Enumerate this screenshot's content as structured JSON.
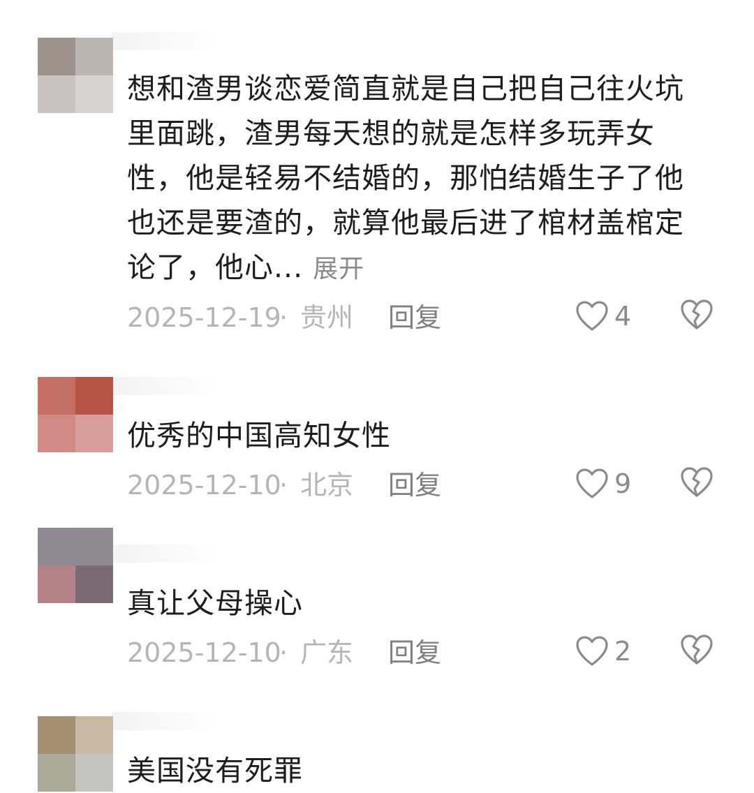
{
  "comments": [
    {
      "text": "想和渣男谈恋爱简直就是自己把自己往火坑里面跳，渣男每天想的就是怎样多玩弄女性，他是轻易不结婚的，那怕结婚生子了他也还是要渣的，就算他最后进了棺材盖棺定论了，他心...",
      "expand_label": "展开",
      "date": "2025-12-19",
      "separator": "·",
      "location": "贵州",
      "reply_label": "回复",
      "likes": "4",
      "avatar_colors": [
        "#9e938c",
        "#bcb5b0",
        "#c9c4c1",
        "#d6d3d1"
      ]
    },
    {
      "text": "优秀的中国高知女性",
      "date": "2025-12-10",
      "separator": "·",
      "location": "北京",
      "reply_label": "回复",
      "likes": "9",
      "avatar_colors": [
        "#c46e66",
        "#b85444",
        "#d08b87",
        "#d99e9c"
      ]
    },
    {
      "text": "真让父母操心",
      "date": "2025-12-10",
      "separator": "·",
      "location": "广东",
      "reply_label": "回复",
      "likes": "2",
      "avatar_colors": [
        "#8d8a91",
        "#8e8b91",
        "#b6828a",
        "#7a6c72"
      ]
    },
    {
      "text": "美国没有死罪",
      "avatar_colors": [
        "#a58f72",
        "#c9b8a2",
        "#a9ab98",
        "#c4c4c0"
      ]
    }
  ],
  "icons": {
    "like": "heart-outline-icon",
    "dislike": "broken-heart-icon"
  },
  "colors": {
    "meta_text": "#b5b5b5",
    "reply_text": "#7f7f7f",
    "icon_stroke": "#8a8a8a"
  }
}
